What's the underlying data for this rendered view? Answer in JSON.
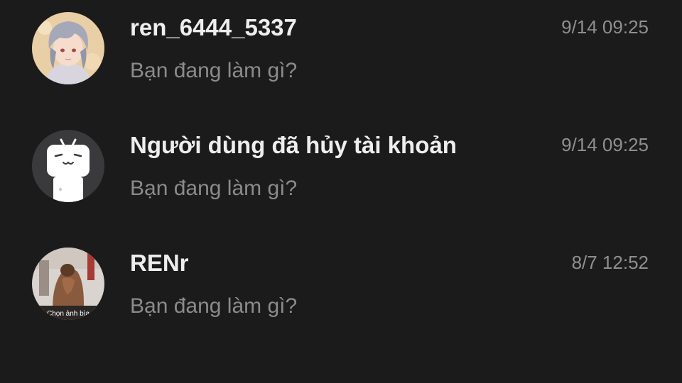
{
  "conversations": [
    {
      "name": "ren_6444_5337",
      "preview": "Bạn đang làm gì?",
      "time": "9/14 09:25",
      "avatar": "anime-character-avatar"
    },
    {
      "name": "Người dùng đã hủy tài khoản",
      "preview": "Bạn đang làm gì?",
      "time": "9/14 09:25",
      "avatar": "default-robot-avatar"
    },
    {
      "name": "RENr",
      "preview": "Bạn đang làm gì?",
      "time": "8/7 12:52",
      "avatar": "photo-avatar",
      "avatar_caption": "Chọn ảnh bìa"
    }
  ],
  "colors": {
    "background": "#1b1b1c",
    "name_text": "#eeeeee",
    "preview_text": "#8b8b8d",
    "time_text": "#8f8f91"
  }
}
